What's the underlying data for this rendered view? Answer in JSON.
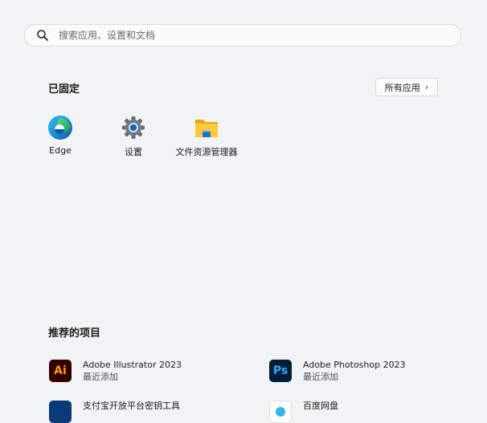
{
  "search": {
    "placeholder": "搜索应用、设置和文档"
  },
  "pinned": {
    "title": "已固定",
    "all_apps_label": "所有应用",
    "apps": [
      {
        "label": "Edge",
        "icon": "edge-icon"
      },
      {
        "label": "设置",
        "icon": "settings-gear-icon"
      },
      {
        "label": "文件资源管理器",
        "icon": "folder-icon"
      }
    ]
  },
  "recommended": {
    "title": "推荐的项目",
    "items": [
      {
        "name": "Adobe Illustrator 2023",
        "subtitle": "最近添加",
        "icon_text": "Ai",
        "icon": "illustrator-icon"
      },
      {
        "name": "Adobe Photoshop 2023",
        "subtitle": "最近添加",
        "icon_text": "Ps",
        "icon": "photoshop-icon"
      },
      {
        "name": "支付宝开放平台密钥工具",
        "subtitle": "",
        "icon": "alipay-tool-icon"
      },
      {
        "name": "百度网盘",
        "subtitle": "",
        "icon": "baidu-netdisk-icon"
      }
    ]
  },
  "colors": {
    "background": "#f2f3f5",
    "ai_bg": "#330000",
    "ai_fg": "#ff9a00",
    "ps_bg": "#001e36",
    "ps_fg": "#31a8ff"
  }
}
